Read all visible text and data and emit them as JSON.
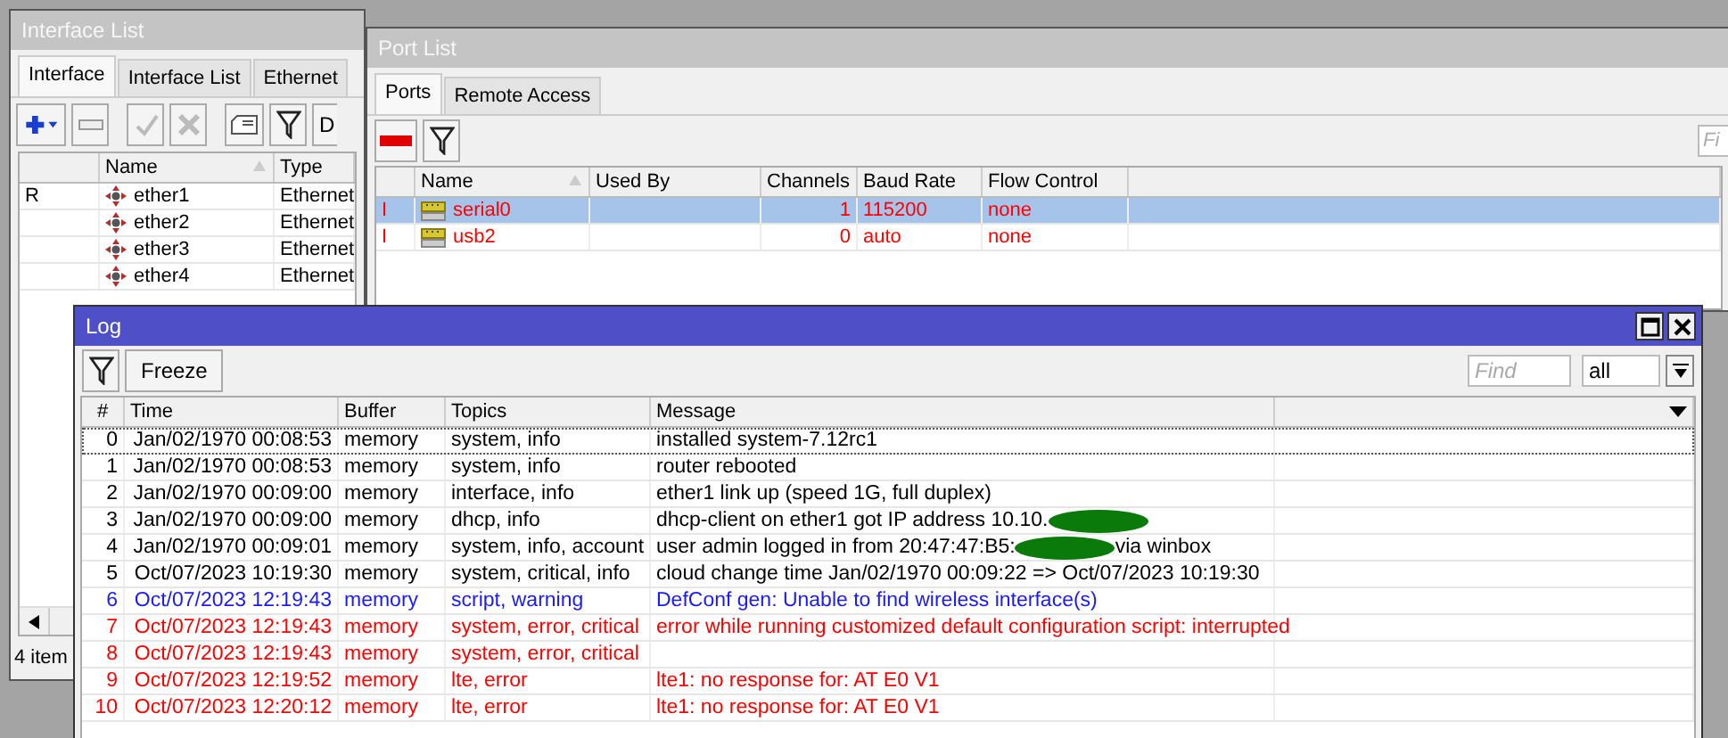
{
  "interface_list": {
    "title": "Interface List",
    "tabs": [
      {
        "label": "Interface",
        "selected": true
      },
      {
        "label": "Interface List",
        "selected": false
      },
      {
        "label": "Ethernet",
        "selected": false
      }
    ],
    "cut_button": "D",
    "columns": [
      "Name",
      "Type"
    ],
    "rows": [
      {
        "flag": "R",
        "name": "ether1",
        "type": "Ethernet"
      },
      {
        "name": "ether2",
        "type": "Ethernet"
      },
      {
        "name": "ether3",
        "type": "Ethernet"
      },
      {
        "name": "ether4",
        "type": "Ethernet"
      }
    ],
    "status": "4 item"
  },
  "port_list": {
    "title": "Port List",
    "tabs": [
      {
        "label": "Ports",
        "selected": true
      },
      {
        "label": "Remote Access",
        "selected": false
      }
    ],
    "find": {
      "placeholder": "Fi"
    },
    "columns": [
      "Name",
      "Used By",
      "Channels",
      "Baud Rate",
      "Flow Control"
    ],
    "rows": [
      {
        "flag": "I",
        "name": "serial0",
        "channels": "1",
        "baud_rate": "115200",
        "flow_control": "none",
        "selected": true
      },
      {
        "flag": "I",
        "name": "usb2",
        "channels": "0",
        "baud_rate": "auto",
        "flow_control": "none",
        "selected": false
      }
    ]
  },
  "log": {
    "title": "Log",
    "freeze_button": "Freeze",
    "find": {
      "placeholder": "Find"
    },
    "filter_value": "all",
    "columns": [
      "#",
      "Time",
      "Buffer",
      "Topics",
      "Message"
    ],
    "rows": [
      {
        "kind": "info",
        "focused": true,
        "num": "0",
        "time": "Jan/02/1970 00:08:53",
        "buffer": "memory",
        "topics": "system, info",
        "message": "installed system-7.12rc1"
      },
      {
        "kind": "info",
        "focused": false,
        "num": "1",
        "time": "Jan/02/1970 00:08:53",
        "buffer": "memory",
        "topics": "system, info",
        "message": "router rebooted"
      },
      {
        "kind": "info",
        "focused": false,
        "num": "2",
        "time": "Jan/02/1970 00:09:00",
        "buffer": "memory",
        "topics": "interface, info",
        "message": "ether1 link up (speed 1G, full duplex)"
      },
      {
        "kind": "info",
        "focused": false,
        "num": "3",
        "time": "Jan/02/1970 00:09:00",
        "buffer": "memory",
        "topics": "dhcp, info",
        "message": "dhcp-client on ether1 got IP address 10.10.",
        "redacted": true
      },
      {
        "kind": "info",
        "focused": false,
        "num": "4",
        "time": "Jan/02/1970 00:09:01",
        "buffer": "memory",
        "topics": "system, info, account",
        "message": "user admin logged in from 20:47:47:B5:",
        "redacted": true,
        "message_after": "via winbox"
      },
      {
        "kind": "info",
        "focused": false,
        "num": "5",
        "time": "Oct/07/2023 10:19:30",
        "buffer": "memory",
        "topics": "system, critical, info",
        "message": "cloud change time Jan/02/1970 00:09:22 => Oct/07/2023 10:19:30"
      },
      {
        "kind": "warning",
        "focused": false,
        "num": "6",
        "time": "Oct/07/2023 12:19:43",
        "buffer": "memory",
        "topics": "script, warning",
        "message": "DefConf gen: Unable to find wireless interface(s)"
      },
      {
        "kind": "error",
        "focused": false,
        "num": "7",
        "time": "Oct/07/2023 12:19:43",
        "buffer": "memory",
        "topics": "system, error, critical",
        "message": "error while running customized default configuration script: interrupted"
      },
      {
        "kind": "error",
        "focused": false,
        "num": "8",
        "time": "Oct/07/2023 12:19:43",
        "buffer": "memory",
        "topics": "system, error, critical"
      },
      {
        "kind": "error",
        "focused": false,
        "num": "9",
        "time": "Oct/07/2023 12:19:52",
        "buffer": "memory",
        "topics": "lte, error",
        "message": "lte1: no response for: AT E0 V1"
      },
      {
        "kind": "error",
        "focused": false,
        "num": "10",
        "time": "Oct/07/2023 12:20:12",
        "buffer": "memory",
        "topics": "lte, error",
        "message": "lte1: no response for: AT E0 V1"
      }
    ]
  }
}
